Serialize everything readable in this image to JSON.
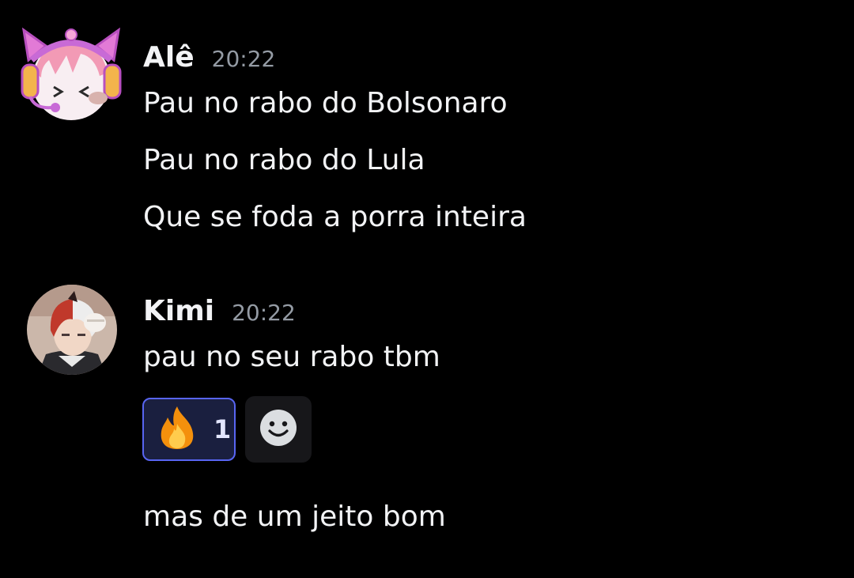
{
  "messages": [
    {
      "author": "Alê",
      "time": "20:22",
      "lines": [
        "Pau no rabo do Bolsonaro",
        "Pau no rabo do Lula",
        "Que se foda a porra inteira"
      ]
    },
    {
      "author": "Kimi",
      "time": "20:22",
      "lines": [
        "pau no seu rabo tbm",
        "mas de um jeito bom"
      ],
      "reactions": [
        {
          "emoji": "fire-icon",
          "count": "1"
        }
      ]
    }
  ],
  "colors": {
    "background": "#000000",
    "text": "#f2f3f5",
    "timestamp": "#949ba4",
    "reaction_border": "#5865f2",
    "reaction_bg": "#1a1f3f"
  }
}
